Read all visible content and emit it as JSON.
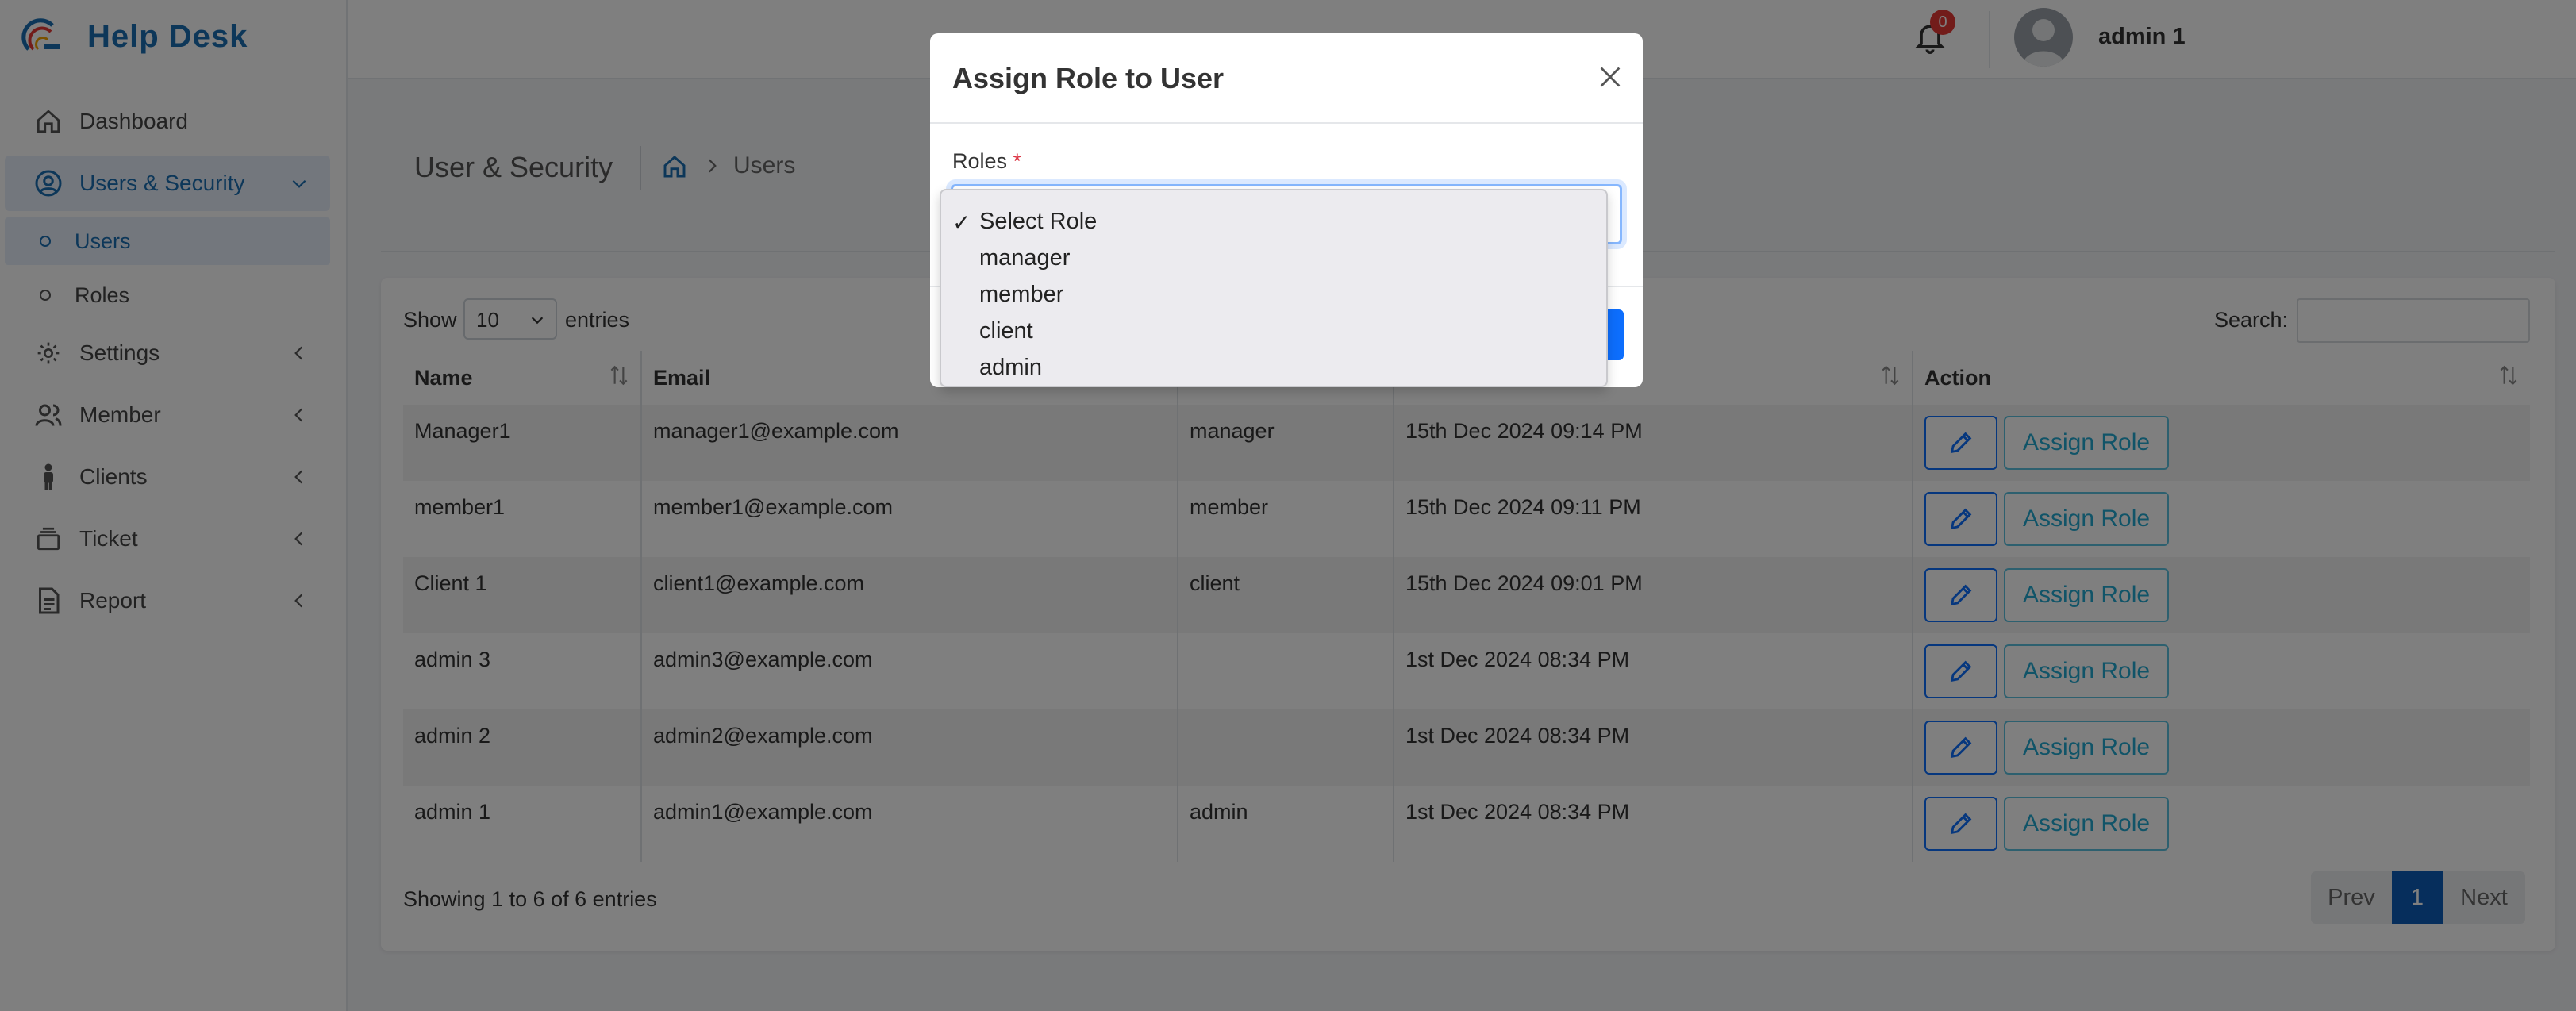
{
  "brand": {
    "title": "Help Desk"
  },
  "sidebar": {
    "items": [
      {
        "label": "Dashboard"
      },
      {
        "label": "Users & Security"
      },
      {
        "label": "Users"
      },
      {
        "label": "Roles"
      },
      {
        "label": "Settings"
      },
      {
        "label": "Member"
      },
      {
        "label": "Clients"
      },
      {
        "label": "Ticket"
      },
      {
        "label": "Report"
      }
    ]
  },
  "topbar": {
    "notification_count": "0",
    "username": "admin 1"
  },
  "page": {
    "title": "User & Security",
    "breadcrumb": "Users"
  },
  "table_controls": {
    "show_label": "Show",
    "entries_value": "10",
    "entries_label": "entries",
    "search_label": "Search:"
  },
  "table": {
    "columns": [
      "Name",
      "Email",
      "",
      "",
      "Action"
    ],
    "rows": [
      {
        "name": "Manager1",
        "email": "manager1@example.com",
        "role": "manager",
        "created": "15th Dec 2024 09:14 PM"
      },
      {
        "name": "member1",
        "email": "member1@example.com",
        "role": "member",
        "created": "15th Dec 2024 09:11 PM"
      },
      {
        "name": "Client 1",
        "email": "client1@example.com",
        "role": "client",
        "created": "15th Dec 2024 09:01 PM"
      },
      {
        "name": "admin 3",
        "email": "admin3@example.com",
        "role": "",
        "created": "1st Dec 2024 08:34 PM"
      },
      {
        "name": "admin 2",
        "email": "admin2@example.com",
        "role": "",
        "created": "1st Dec 2024 08:34 PM"
      },
      {
        "name": "admin 1",
        "email": "admin1@example.com",
        "role": "admin",
        "created": "1st Dec 2024 08:34 PM"
      }
    ],
    "assign_label": "Assign Role"
  },
  "footer": {
    "info": "Showing 1 to 6 of 6 entries",
    "prev": "Prev",
    "page": "1",
    "next": "Next"
  },
  "modal": {
    "title": "Assign Role to User",
    "roles_label": "Roles",
    "required_mark": "*",
    "options": [
      "Select Role",
      "manager",
      "member",
      "client",
      "admin"
    ],
    "selected_check": "✓"
  },
  "colors": {
    "brand": "#1a6fb3",
    "primary": "#0d6efd",
    "info": "#5bc0de",
    "badge": "#e53935"
  }
}
